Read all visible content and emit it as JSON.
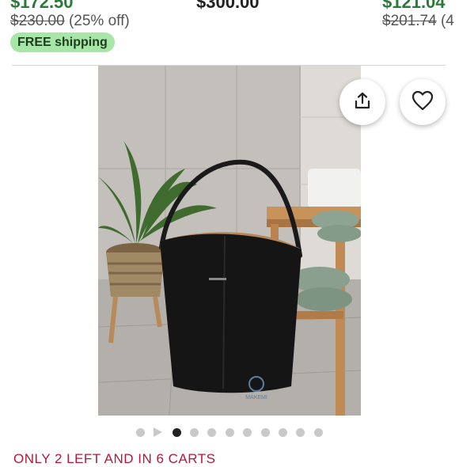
{
  "listings_row": {
    "left": {
      "price": "$172.50",
      "original_price": "$230.00",
      "discount": "(25% off)",
      "shipping": "FREE shipping"
    },
    "center": {
      "price": "$300.00"
    },
    "right": {
      "price": "$121.04",
      "original_price": "$201.74",
      "discount": "(4"
    }
  },
  "product_image": {
    "alt": "Black leather bucket tote bag on bathroom floor beside plant and wooden bench",
    "watermark": "MAKEMI"
  },
  "actions": {
    "share_icon": "share-icon",
    "favorite_icon": "heart-icon"
  },
  "carousel": {
    "total_dots": 10,
    "active_index": 2,
    "video_marker_index": 1
  },
  "stock_message": "ONLY 2 LEFT AND IN 6 CARTS",
  "colors": {
    "sale_price": "#2b7a3b",
    "shipping_badge": "#a6e6a6",
    "stock_alert": "#b1193b"
  }
}
